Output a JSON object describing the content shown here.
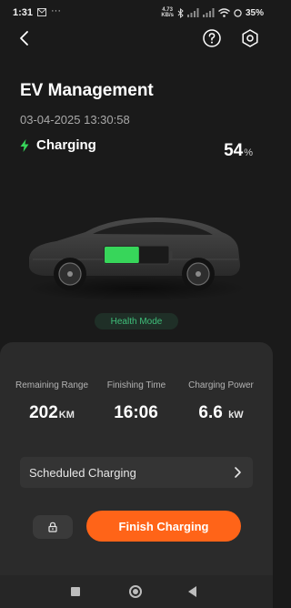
{
  "status_bar": {
    "time": "1:31",
    "notification_icons": [
      "mail-icon",
      "more-dots-icon"
    ],
    "network_speed_value": "4.73",
    "network_speed_unit": "KB/s",
    "status_icons": [
      "bluetooth-icon",
      "signal-icon",
      "signal-icon",
      "wifi-icon",
      "battery-icon"
    ],
    "battery": "35%"
  },
  "header": {
    "title": "EV Management",
    "timestamp": "03-04-2025 13:30:58"
  },
  "charging": {
    "status": "Charging",
    "percent_value": "54",
    "percent_unit": "%",
    "level": 0.54,
    "accent": "#37d65a"
  },
  "health_mode": {
    "label": "Health Mode",
    "color": "#3fbf7a"
  },
  "stats": [
    {
      "label": "Remaining Range",
      "value": "202",
      "unit": "KM"
    },
    {
      "label": "Finishing Time",
      "value": "16:06",
      "unit": ""
    },
    {
      "label": "Charging Power",
      "value": "6.6",
      "unit": "kW"
    }
  ],
  "scheduled": {
    "label": "Scheduled Charging"
  },
  "actions": {
    "finish_label": "Finish Charging",
    "finish_color": "#ff6418"
  },
  "nav_bar": {
    "buttons": [
      "recent-apps",
      "home",
      "back"
    ]
  }
}
